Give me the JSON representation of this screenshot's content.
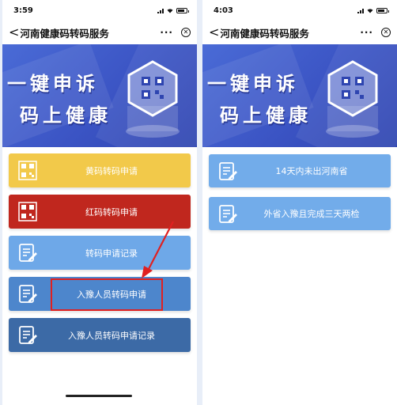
{
  "phone1": {
    "status": {
      "time": "3:59"
    },
    "nav": {
      "back_glyph": "<",
      "title": "河南健康码转码服务",
      "more": "···",
      "close": "✕"
    },
    "banner": {
      "line1": "一键申诉",
      "line2": "码上健康"
    },
    "buttons": [
      {
        "label": "黄码转码申请",
        "color": "#f2c94a",
        "icon": "qrcode-icon"
      },
      {
        "label": "红码转码申请",
        "color": "#c0271e",
        "icon": "qrcode-icon"
      },
      {
        "label": "转码申请记录",
        "color": "#6ea8e8",
        "icon": "form-edit-icon"
      },
      {
        "label": "入豫人员转码申请",
        "color": "#4d86cc",
        "icon": "form-edit-icon"
      },
      {
        "label": "入豫人员转码申请记录",
        "color": "#3c6aa6",
        "icon": "form-edit-icon"
      }
    ]
  },
  "phone2": {
    "status": {
      "time": "4:03"
    },
    "nav": {
      "back_glyph": "<",
      "title": "河南健康码转码服务",
      "more": "···",
      "close": "✕"
    },
    "banner": {
      "line1": "一键申诉",
      "line2": "码上健康"
    },
    "buttons": [
      {
        "label": "14天内未出河南省",
        "color": "#72acea",
        "icon": "form-edit-icon"
      },
      {
        "label": "外省入豫且完成三天两检",
        "color": "#72acea",
        "icon": "form-edit-icon"
      }
    ]
  },
  "annotation": {
    "highlight_color": "#e02020"
  }
}
